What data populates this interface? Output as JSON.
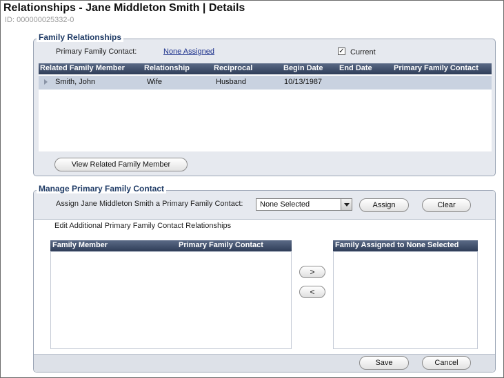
{
  "header": {
    "title": "Relationships - Jane Middleton Smith  |  Details",
    "id_label": "ID: 000000025332-0"
  },
  "family_relationships": {
    "section_title": "Family Relationships",
    "primary_contact_label": "Primary Family Contact:",
    "primary_contact_value": "None Assigned",
    "current_label": "Current",
    "current_checked": true,
    "columns": [
      "Related Family Member",
      "Relationship",
      "Reciprocal",
      "Begin Date",
      "End Date",
      "Primary Family Contact"
    ],
    "rows": [
      {
        "member": "Smith, John",
        "relationship": "Wife",
        "reciprocal": "Husband",
        "begin_date": "10/13/1987",
        "end_date": "",
        "primary_contact": ""
      }
    ],
    "view_button": "View Related Family Member"
  },
  "manage_contact": {
    "section_title": "Manage Primary Family Contact",
    "assign_label": "Assign Jane Middleton Smith a Primary Family Contact:",
    "select_value": "None Selected",
    "assign_button": "Assign",
    "clear_button": "Clear",
    "edit_label": "Edit Additional Primary Family Contact Relationships",
    "left_columns": [
      "Family Member",
      "Primary Family Contact"
    ],
    "right_column": "Family Assigned to None Selected",
    "move_right": ">",
    "move_left": "<",
    "save_button": "Save",
    "cancel_button": "Cancel"
  },
  "colors": {
    "header_blue": "#2f3d58",
    "section_title": "#1f3b66",
    "panel_bg": "#e6e9ef",
    "selected_row": "#c9d2e0"
  }
}
